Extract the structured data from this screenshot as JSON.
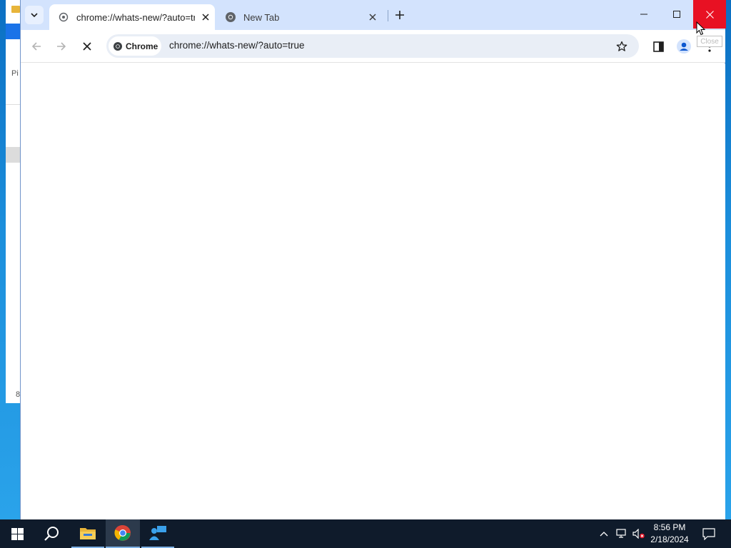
{
  "browser": {
    "tabs": [
      {
        "title": "chrome://whats-new/?auto=true",
        "active": true
      },
      {
        "title": "New Tab",
        "active": false
      }
    ],
    "omnibox": {
      "chip_label": "Chrome",
      "url": "chrome://whats-new/?auto=true"
    },
    "window_controls": {
      "tooltip": "Close"
    }
  },
  "background_window": {
    "label_fragment_top": "Pi",
    "label_fragment_bottom": "8"
  },
  "taskbar": {
    "clock": {
      "time": "8:56 PM",
      "date": "2/18/2024"
    }
  },
  "colors": {
    "titlebar": "#d3e3fd",
    "omnibox": "#e9eef6",
    "close_hover": "#e81123",
    "taskbar": "#0f1b2b"
  },
  "icons": [
    "tab-search-icon",
    "globe-icon",
    "close-icon",
    "plus-icon",
    "minimize-icon",
    "maximize-icon",
    "back-arrow-icon",
    "forward-arrow-icon",
    "stop-icon",
    "chrome-logo-icon",
    "star-icon",
    "side-panel-icon",
    "profile-icon",
    "more-vert-icon",
    "windows-start-icon",
    "search-icon",
    "file-explorer-icon",
    "chrome-icon",
    "people-app-icon",
    "tray-chevron-icon",
    "network-icon",
    "volume-muted-icon",
    "notification-icon"
  ]
}
